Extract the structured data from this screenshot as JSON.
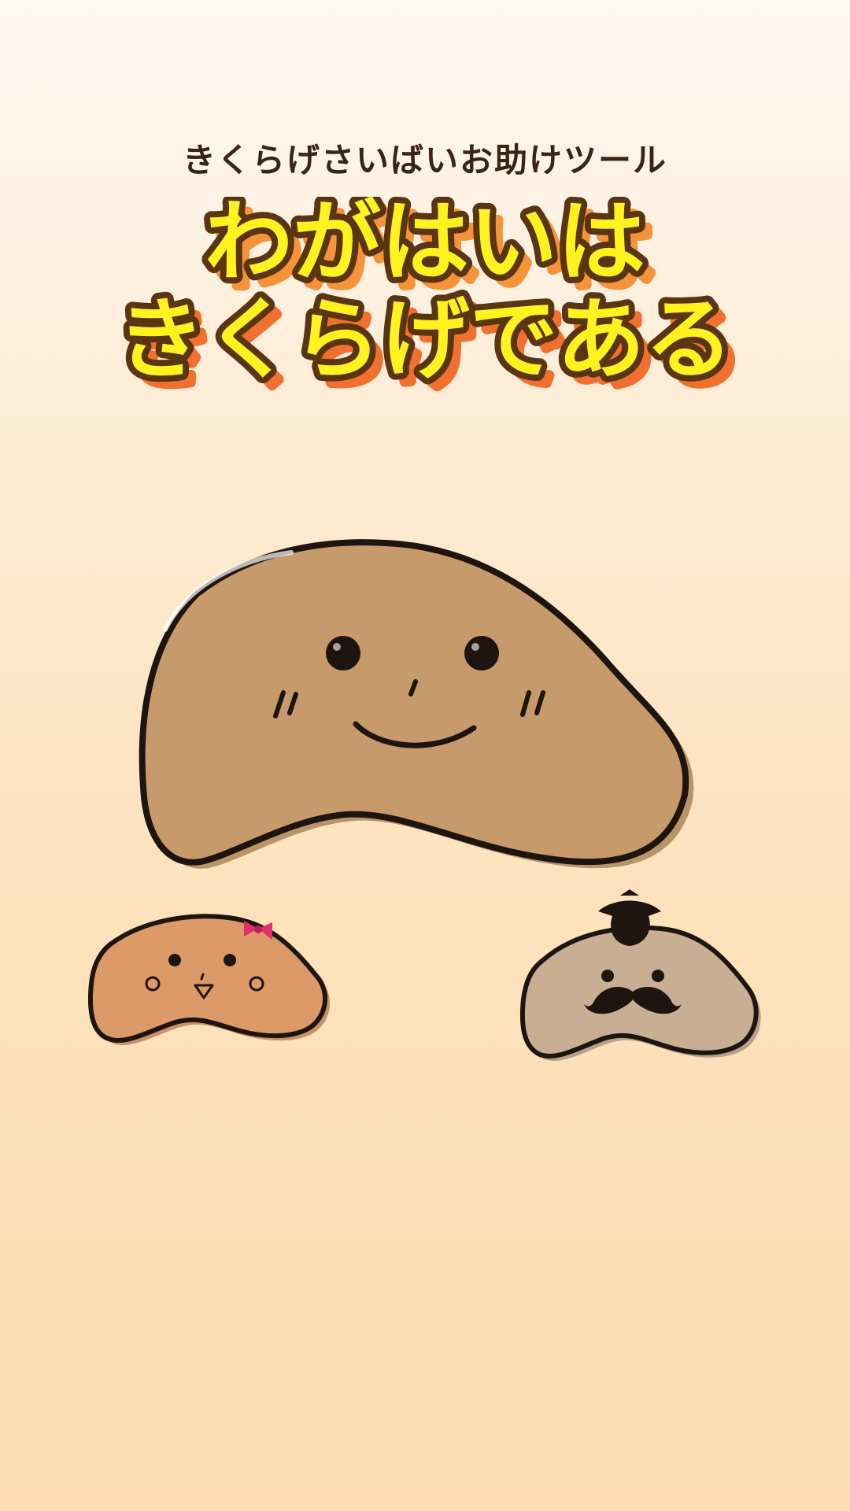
{
  "header": {
    "subtitle": "きくらげさいばいお助けツール",
    "title_line1": "わがはいは",
    "title_line2": "きくらげである"
  },
  "colors": {
    "background_top": "#fff9f2",
    "background_bottom": "#fcdcb0",
    "title_fill": "#fff21f",
    "title_shadow_orange": "#f6923a",
    "title_outline": "#5a3512",
    "main_mascot_fill": "#c69a6b",
    "girl_mascot_fill": "#dc9a68",
    "gentleman_mascot_fill": "#c8ae92",
    "bow_color": "#e0306b",
    "ink": "#1e1410"
  },
  "icons": {
    "main_mascot": "smiling-kikurage-mascot",
    "girl_mascot": "kikurage-girl-with-bow",
    "gentleman_mascot": "kikurage-gentleman-with-mustache"
  }
}
